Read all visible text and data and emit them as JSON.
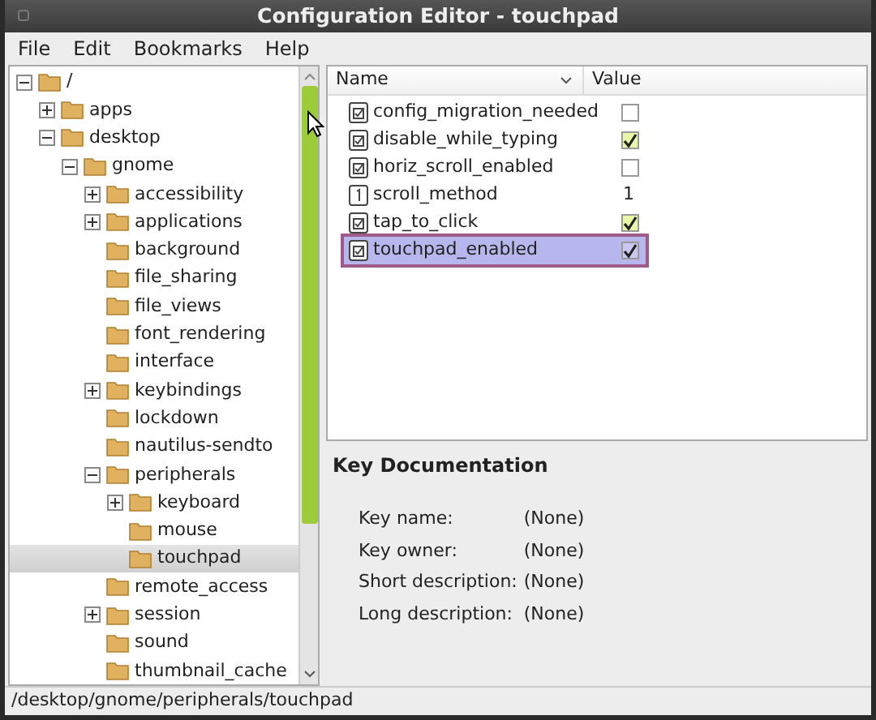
{
  "window": {
    "title": "Configuration Editor - touchpad"
  },
  "menu": [
    "File",
    "Edit",
    "Bookmarks",
    "Help"
  ],
  "tree": [
    {
      "label": "/",
      "expanded": true,
      "selected": false,
      "children": [
        {
          "label": "apps",
          "expanded": false,
          "selected": false
        },
        {
          "label": "desktop",
          "expanded": true,
          "selected": false,
          "children": [
            {
              "label": "gnome",
              "expanded": true,
              "selected": false,
              "children": [
                {
                  "label": "accessibility",
                  "expanded": false,
                  "selected": false
                },
                {
                  "label": "applications",
                  "expanded": false,
                  "selected": false
                },
                {
                  "label": "background",
                  "selected": false
                },
                {
                  "label": "file_sharing",
                  "selected": false
                },
                {
                  "label": "file_views",
                  "selected": false
                },
                {
                  "label": "font_rendering",
                  "selected": false
                },
                {
                  "label": "interface",
                  "selected": false
                },
                {
                  "label": "keybindings",
                  "expanded": false,
                  "selected": false
                },
                {
                  "label": "lockdown",
                  "selected": false
                },
                {
                  "label": "nautilus-sendto",
                  "selected": false
                },
                {
                  "label": "peripherals",
                  "expanded": true,
                  "selected": false,
                  "children": [
                    {
                      "label": "keyboard",
                      "expanded": false,
                      "selected": false
                    },
                    {
                      "label": "mouse",
                      "selected": false
                    },
                    {
                      "label": "touchpad",
                      "selected": true
                    }
                  ]
                },
                {
                  "label": "remote_access",
                  "selected": false
                },
                {
                  "label": "session",
                  "expanded": false,
                  "selected": false
                },
                {
                  "label": "sound",
                  "selected": false
                },
                {
                  "label": "thumbnail_cache",
                  "selected": false
                }
              ]
            }
          ]
        }
      ]
    }
  ],
  "keys_table": {
    "columns": [
      "Name",
      "Value"
    ],
    "rows": [
      {
        "name": "config_migration_needed",
        "kind": "bool",
        "checked": false,
        "selected": false
      },
      {
        "name": "disable_while_typing",
        "kind": "bool",
        "checked": true,
        "selected": false
      },
      {
        "name": "horiz_scroll_enabled",
        "kind": "bool",
        "checked": false,
        "selected": false
      },
      {
        "name": "scroll_method",
        "kind": "int",
        "value": "1",
        "selected": false
      },
      {
        "name": "tap_to_click",
        "kind": "bool",
        "checked": true,
        "selected": false
      },
      {
        "name": "touchpad_enabled",
        "kind": "bool",
        "checked": true,
        "selected": true
      }
    ]
  },
  "documentation": {
    "title": "Key Documentation",
    "fields": [
      {
        "label": "Key name:",
        "value": "(None)"
      },
      {
        "label": "Key owner:",
        "value": "(None)"
      },
      {
        "label": "Short description:",
        "value": "(None)"
      },
      {
        "label": "Long description:",
        "value": "(None)"
      }
    ]
  },
  "status_bar": "/desktop/gnome/peripherals/touchpad"
}
